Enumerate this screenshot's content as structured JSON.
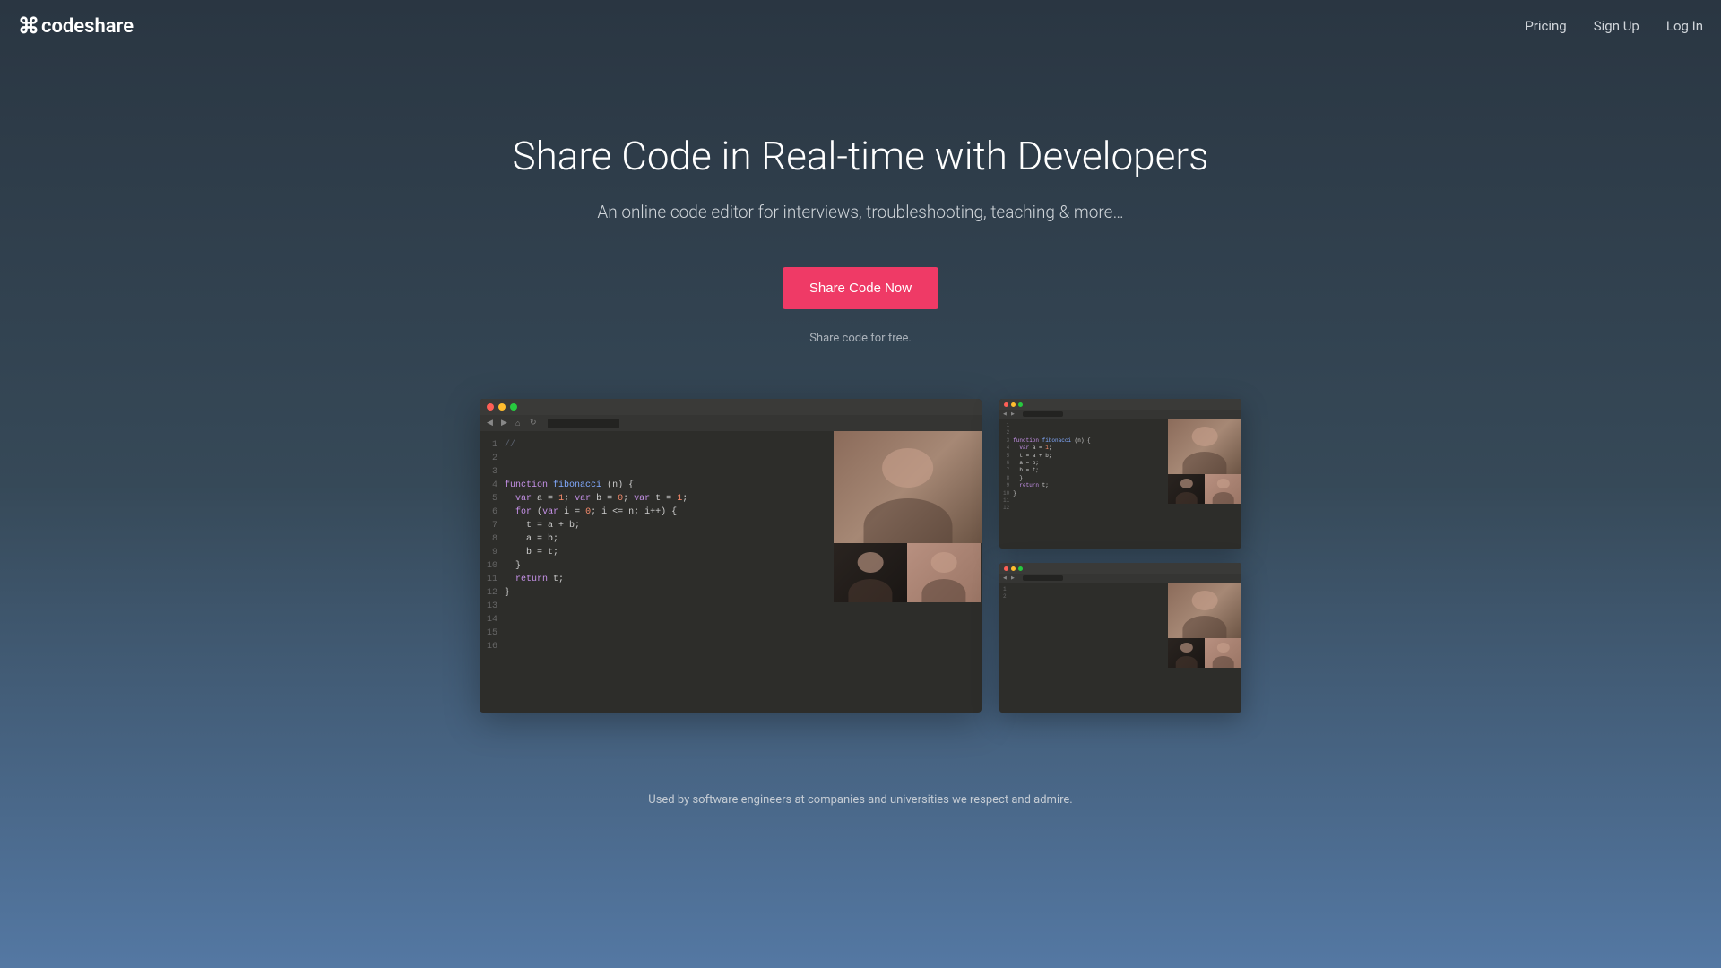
{
  "header": {
    "logo": "codeshare",
    "nav": {
      "pricing": "Pricing",
      "signup": "Sign Up",
      "login": "Log In"
    }
  },
  "hero": {
    "title": "Share Code in Real-time with Developers",
    "subtitle": "An online code editor for interviews, troubleshooting, teaching & more…",
    "cta": "Share Code Now",
    "cta_subtext": "Share code for free."
  },
  "code": {
    "lines": [
      "",
      "",
      "",
      "function fibonacci (n) {",
      "  var a = 1; var b = 0; var t = 1;",
      "  for (var i = 0; i <= n; i++) {",
      "    t = a + b;",
      "    a = b;",
      "    b = t;",
      "  }",
      "  return t;",
      "}",
      "",
      "",
      "",
      ""
    ],
    "line_count": 16
  },
  "footer": {
    "tagline": "Used by software engineers at companies and universities we respect and admire."
  }
}
